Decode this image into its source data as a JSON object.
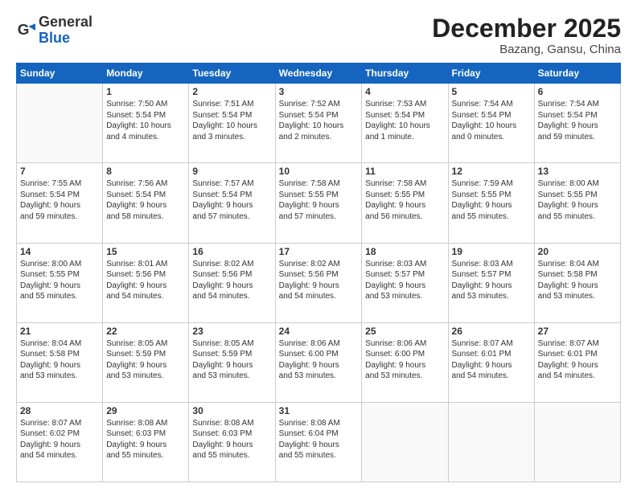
{
  "header": {
    "logo_general": "General",
    "logo_blue": "Blue",
    "month_title": "December 2025",
    "location": "Bazang, Gansu, China"
  },
  "weekdays": [
    "Sunday",
    "Monday",
    "Tuesday",
    "Wednesday",
    "Thursday",
    "Friday",
    "Saturday"
  ],
  "weeks": [
    [
      {
        "day": "",
        "text": ""
      },
      {
        "day": "1",
        "text": "Sunrise: 7:50 AM\nSunset: 5:54 PM\nDaylight: 10 hours\nand 4 minutes."
      },
      {
        "day": "2",
        "text": "Sunrise: 7:51 AM\nSunset: 5:54 PM\nDaylight: 10 hours\nand 3 minutes."
      },
      {
        "day": "3",
        "text": "Sunrise: 7:52 AM\nSunset: 5:54 PM\nDaylight: 10 hours\nand 2 minutes."
      },
      {
        "day": "4",
        "text": "Sunrise: 7:53 AM\nSunset: 5:54 PM\nDaylight: 10 hours\nand 1 minute."
      },
      {
        "day": "5",
        "text": "Sunrise: 7:54 AM\nSunset: 5:54 PM\nDaylight: 10 hours\nand 0 minutes."
      },
      {
        "day": "6",
        "text": "Sunrise: 7:54 AM\nSunset: 5:54 PM\nDaylight: 9 hours\nand 59 minutes."
      }
    ],
    [
      {
        "day": "7",
        "text": "Sunrise: 7:55 AM\nSunset: 5:54 PM\nDaylight: 9 hours\nand 59 minutes."
      },
      {
        "day": "8",
        "text": "Sunrise: 7:56 AM\nSunset: 5:54 PM\nDaylight: 9 hours\nand 58 minutes."
      },
      {
        "day": "9",
        "text": "Sunrise: 7:57 AM\nSunset: 5:54 PM\nDaylight: 9 hours\nand 57 minutes."
      },
      {
        "day": "10",
        "text": "Sunrise: 7:58 AM\nSunset: 5:55 PM\nDaylight: 9 hours\nand 57 minutes."
      },
      {
        "day": "11",
        "text": "Sunrise: 7:58 AM\nSunset: 5:55 PM\nDaylight: 9 hours\nand 56 minutes."
      },
      {
        "day": "12",
        "text": "Sunrise: 7:59 AM\nSunset: 5:55 PM\nDaylight: 9 hours\nand 55 minutes."
      },
      {
        "day": "13",
        "text": "Sunrise: 8:00 AM\nSunset: 5:55 PM\nDaylight: 9 hours\nand 55 minutes."
      }
    ],
    [
      {
        "day": "14",
        "text": "Sunrise: 8:00 AM\nSunset: 5:55 PM\nDaylight: 9 hours\nand 55 minutes."
      },
      {
        "day": "15",
        "text": "Sunrise: 8:01 AM\nSunset: 5:56 PM\nDaylight: 9 hours\nand 54 minutes."
      },
      {
        "day": "16",
        "text": "Sunrise: 8:02 AM\nSunset: 5:56 PM\nDaylight: 9 hours\nand 54 minutes."
      },
      {
        "day": "17",
        "text": "Sunrise: 8:02 AM\nSunset: 5:56 PM\nDaylight: 9 hours\nand 54 minutes."
      },
      {
        "day": "18",
        "text": "Sunrise: 8:03 AM\nSunset: 5:57 PM\nDaylight: 9 hours\nand 53 minutes."
      },
      {
        "day": "19",
        "text": "Sunrise: 8:03 AM\nSunset: 5:57 PM\nDaylight: 9 hours\nand 53 minutes."
      },
      {
        "day": "20",
        "text": "Sunrise: 8:04 AM\nSunset: 5:58 PM\nDaylight: 9 hours\nand 53 minutes."
      }
    ],
    [
      {
        "day": "21",
        "text": "Sunrise: 8:04 AM\nSunset: 5:58 PM\nDaylight: 9 hours\nand 53 minutes."
      },
      {
        "day": "22",
        "text": "Sunrise: 8:05 AM\nSunset: 5:59 PM\nDaylight: 9 hours\nand 53 minutes."
      },
      {
        "day": "23",
        "text": "Sunrise: 8:05 AM\nSunset: 5:59 PM\nDaylight: 9 hours\nand 53 minutes."
      },
      {
        "day": "24",
        "text": "Sunrise: 8:06 AM\nSunset: 6:00 PM\nDaylight: 9 hours\nand 53 minutes."
      },
      {
        "day": "25",
        "text": "Sunrise: 8:06 AM\nSunset: 6:00 PM\nDaylight: 9 hours\nand 53 minutes."
      },
      {
        "day": "26",
        "text": "Sunrise: 8:07 AM\nSunset: 6:01 PM\nDaylight: 9 hours\nand 54 minutes."
      },
      {
        "day": "27",
        "text": "Sunrise: 8:07 AM\nSunset: 6:01 PM\nDaylight: 9 hours\nand 54 minutes."
      }
    ],
    [
      {
        "day": "28",
        "text": "Sunrise: 8:07 AM\nSunset: 6:02 PM\nDaylight: 9 hours\nand 54 minutes."
      },
      {
        "day": "29",
        "text": "Sunrise: 8:08 AM\nSunset: 6:03 PM\nDaylight: 9 hours\nand 55 minutes."
      },
      {
        "day": "30",
        "text": "Sunrise: 8:08 AM\nSunset: 6:03 PM\nDaylight: 9 hours\nand 55 minutes."
      },
      {
        "day": "31",
        "text": "Sunrise: 8:08 AM\nSunset: 6:04 PM\nDaylight: 9 hours\nand 55 minutes."
      },
      {
        "day": "",
        "text": ""
      },
      {
        "day": "",
        "text": ""
      },
      {
        "day": "",
        "text": ""
      }
    ]
  ]
}
